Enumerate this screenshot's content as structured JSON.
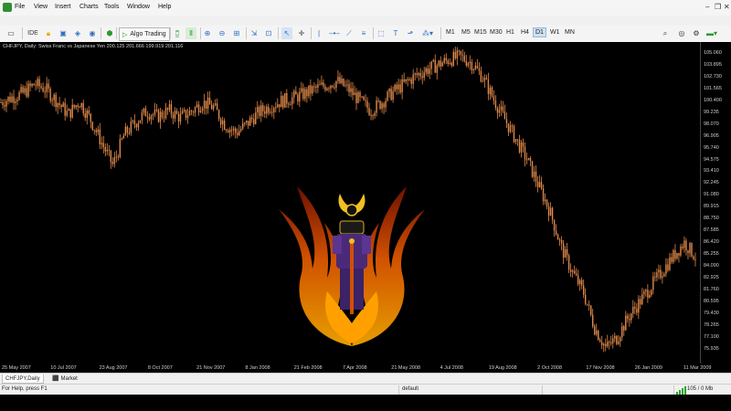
{
  "menu": {
    "items": [
      "File",
      "View",
      "Insert",
      "Charts",
      "Tools",
      "Window",
      "Help"
    ]
  },
  "toolbar": {
    "ide_label": "IDE",
    "algo_trading_label": "Algo Trading",
    "timeframes": [
      "M1",
      "M5",
      "M15",
      "M30",
      "H1",
      "H4",
      "D1",
      "W1",
      "MN"
    ],
    "active_timeframe": "D1"
  },
  "chart": {
    "info_text": "CHFJPY, Daily:  Swiss Franc vs Japanese Yen  200.125 201.666 199.919 201.116",
    "candle_color": "#e0894a",
    "background": "#000000"
  },
  "chart_data": {
    "type": "line",
    "symbol": "CHFJPY",
    "timeframe": "Daily",
    "y_ticks": [
      "105.060",
      "103.895",
      "102.730",
      "101.565",
      "100.400",
      "99.235",
      "98.070",
      "96.905",
      "95.740",
      "94.575",
      "93.410",
      "92.245",
      "91.080",
      "89.915",
      "88.750",
      "87.585",
      "86.420",
      "85.255",
      "84.090",
      "82.925",
      "81.760",
      "80.595",
      "79.430",
      "78.265",
      "77.100",
      "75.935"
    ],
    "x_ticks": [
      "25 May 2007",
      "10 Jul 2007",
      "23 Aug 2007",
      "8 Oct 2007",
      "21 Nov 2007",
      "8 Jan 2008",
      "21 Feb 2008",
      "7 Apr 2008",
      "21 May 2008",
      "4 Jul 2008",
      "19 Aug 2008",
      "2 Oct 2008",
      "17 Nov 2008",
      "26 Jan 2009",
      "11 Mar 2009"
    ],
    "ylim": [
      75.0,
      105.6
    ],
    "close_series": [
      100.2,
      100.7,
      101.1,
      102.0,
      101.5,
      100.3,
      99.0,
      100.3,
      98.5,
      96.2,
      94.0,
      97.0,
      98.2,
      99.3,
      98.8,
      99.4,
      98.7,
      99.3,
      100.2,
      99.7,
      98.0,
      97.2,
      98.1,
      99.2,
      99.8,
      100.3,
      100.6,
      101.0,
      101.5,
      101.9,
      102.3,
      101.5,
      100.4,
      99.4,
      100.2,
      101.2,
      102.0,
      102.8,
      103.4,
      103.9,
      104.4,
      104.7,
      104.1,
      102.7,
      100.5,
      98.5,
      96.5,
      94.5,
      92.0,
      89.5,
      86.0,
      83.5,
      81.5,
      78.0,
      76.0,
      77.0,
      79.0,
      80.5,
      82.0,
      83.5,
      85.0,
      86.4,
      85.0
    ]
  },
  "tabs": {
    "chart_tab": "CHFJPY,Daily",
    "market_tab": "Market"
  },
  "status": {
    "help_text": "For Help, press F1",
    "profile": "default",
    "traffic": "105 / 0 Mb"
  }
}
